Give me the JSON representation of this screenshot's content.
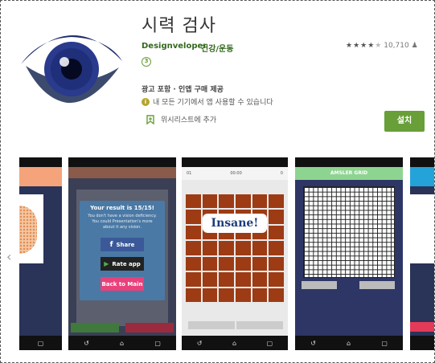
{
  "app": {
    "title": "시력 검사",
    "developer": "Designveloper",
    "category": "건강/운동",
    "rating_stars": "★★★★",
    "rating_star_empty": "★",
    "rating_count": "10,710",
    "age_badge": "3",
    "ads_text": "광고 포함 · 인앱 구매 제공",
    "compat_text": "내 모든 기기에서 앱 사용할 수 있습니다",
    "wishlist_label": "위시리스트에 추가",
    "install_label": "설치"
  },
  "colors": {
    "accent": "#689f38",
    "developer_text": "#33691e"
  },
  "screenshots": {
    "shot2": {
      "dialog_title": "Your result is 15/15!",
      "dialog_sub": "You don't have a vision deficiency. You could Presentation's more about it any vision.",
      "share_label": "Share",
      "rate_label": "Rate app",
      "back_label": "Back to Main"
    },
    "shot3": {
      "banner": "Insane!"
    },
    "shot4": {
      "header": "AMSLER GRID"
    }
  },
  "icons": {
    "eye_icon": "eye-icon",
    "wishlist_icon": "bookmark-plus-icon",
    "info_icon": "info-icon",
    "person_icon": "person-icon",
    "prev_arrow": "chevron-left-icon",
    "next_arrow": "chevron-right-icon"
  }
}
